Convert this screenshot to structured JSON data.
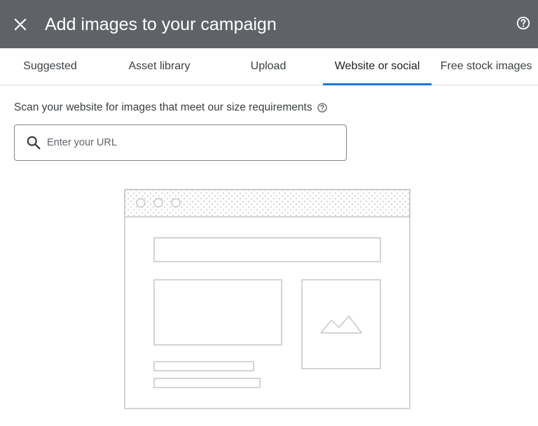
{
  "header": {
    "title": "Add images to your campaign",
    "close_icon": "close-icon",
    "help_icon": "help-circle-icon",
    "background": "#5f6368"
  },
  "tabs": [
    {
      "label": "Suggested",
      "active": false
    },
    {
      "label": "Asset library",
      "active": false
    },
    {
      "label": "Upload",
      "active": false
    },
    {
      "label": "Website or social",
      "active": true
    },
    {
      "label": "Free stock images",
      "active": false
    }
  ],
  "accent_color": "#1a73e8",
  "scan": {
    "text": "Scan your website for images that meet our size requirements",
    "help_icon": "help-circle-icon"
  },
  "url_field": {
    "placeholder": "Enter your URL",
    "value": "",
    "icon": "search-icon"
  },
  "illustration": {
    "name": "website-placeholder-illustration",
    "icon": "image-mountain-icon"
  }
}
